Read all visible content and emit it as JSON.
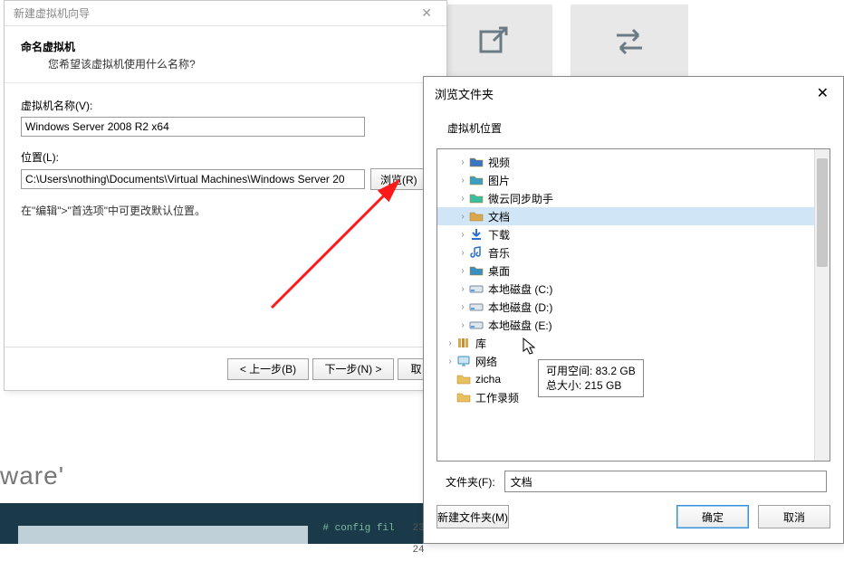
{
  "background": {
    "ware_text": "ware'",
    "term_code1": "# config fil",
    "term_ln1": "23",
    "term_ln2": "24"
  },
  "wizard": {
    "title": "新建虚拟机向导",
    "heading": "命名虚拟机",
    "subheading": "您希望该虚拟机使用什么名称?",
    "name_label": "虚拟机名称(V):",
    "name_value": "Windows Server 2008 R2 x64",
    "location_label": "位置(L):",
    "location_value": "C:\\Users\\nothing\\Documents\\Virtual Machines\\Windows Server 20",
    "browse_label": "浏览(R)",
    "hint": "在\"编辑\">\"首选项\"中可更改默认位置。",
    "back": "< 上一步(B)",
    "next": "下一步(N) >",
    "cancel": "取"
  },
  "browse": {
    "title": "浏览文件夹",
    "subtitle": "虚拟机位置",
    "tree": [
      {
        "icon": "video",
        "label": "视频",
        "indent": 1,
        "exp": "›"
      },
      {
        "icon": "pic",
        "label": "图片",
        "indent": 1,
        "exp": "›"
      },
      {
        "icon": "sync",
        "label": "微云同步助手",
        "indent": 1,
        "exp": "›"
      },
      {
        "icon": "doc",
        "label": "文档",
        "indent": 1,
        "exp": "›",
        "selected": true
      },
      {
        "icon": "down",
        "label": "下载",
        "indent": 1,
        "exp": "›"
      },
      {
        "icon": "music",
        "label": "音乐",
        "indent": 1,
        "exp": "›"
      },
      {
        "icon": "desk",
        "label": "桌面",
        "indent": 1,
        "exp": "›"
      },
      {
        "icon": "disk",
        "label": "本地磁盘 (C:)",
        "indent": 1,
        "exp": "›"
      },
      {
        "icon": "disk",
        "label": "本地磁盘 (D:)",
        "indent": 1,
        "exp": "›"
      },
      {
        "icon": "disk",
        "label": "本地磁盘 (E:)",
        "indent": 1,
        "exp": "›"
      },
      {
        "icon": "lib",
        "label": "库",
        "indent": 0,
        "exp": "›"
      },
      {
        "icon": "net",
        "label": "网络",
        "indent": 0,
        "exp": "›"
      },
      {
        "icon": "folder",
        "label": "zicha",
        "indent": 0,
        "exp": ""
      },
      {
        "icon": "folder",
        "label": "工作录频",
        "indent": 0,
        "exp": ""
      }
    ],
    "tooltip_l1": "可用空间: 83.2 GB",
    "tooltip_l2": "总大小: 215 GB",
    "folder_label": "文件夹(F):",
    "folder_value": "文档",
    "new_folder": "新建文件夹(M)",
    "ok": "确定",
    "cancel": "取消"
  }
}
